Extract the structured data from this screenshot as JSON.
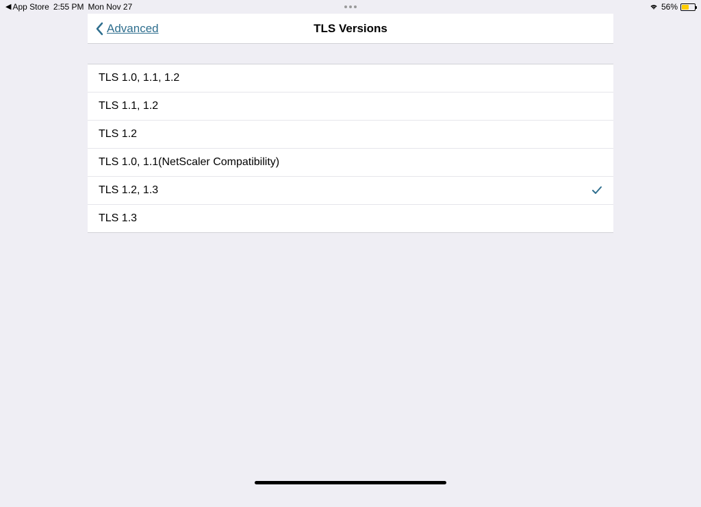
{
  "statusBar": {
    "returnApp": "App Store",
    "time": "2:55 PM",
    "date": "Mon Nov 27",
    "batteryPercent": "56%"
  },
  "navBar": {
    "backLabel": "Advanced",
    "title": "TLS Versions"
  },
  "options": [
    {
      "label": "TLS 1.0, 1.1, 1.2",
      "selected": false
    },
    {
      "label": "TLS 1.1, 1.2",
      "selected": false
    },
    {
      "label": "TLS 1.2",
      "selected": false
    },
    {
      "label": "TLS 1.0, 1.1(NetScaler Compatibility)",
      "selected": false
    },
    {
      "label": "TLS 1.2, 1.3",
      "selected": true
    },
    {
      "label": "TLS 1.3",
      "selected": false
    }
  ]
}
